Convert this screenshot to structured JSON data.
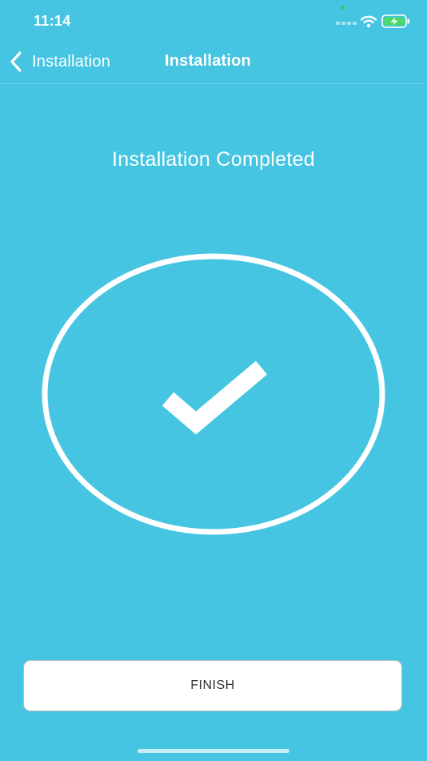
{
  "status_bar": {
    "time": "11:14",
    "icons": [
      "signal-icon",
      "wifi-icon",
      "battery-charging-icon"
    ]
  },
  "nav": {
    "back_label": "Installation",
    "title": "Installation"
  },
  "main": {
    "heading": "Installation Completed",
    "graphic": "check-circle-icon"
  },
  "finish_button": {
    "label": "FINISH"
  },
  "colors": {
    "background": "#45C5E1",
    "foreground": "#FFFFFF",
    "button_background": "#FFFFFF",
    "button_text": "#333333",
    "battery_fill": "#4CD964",
    "green_indicator": "#34C759"
  }
}
